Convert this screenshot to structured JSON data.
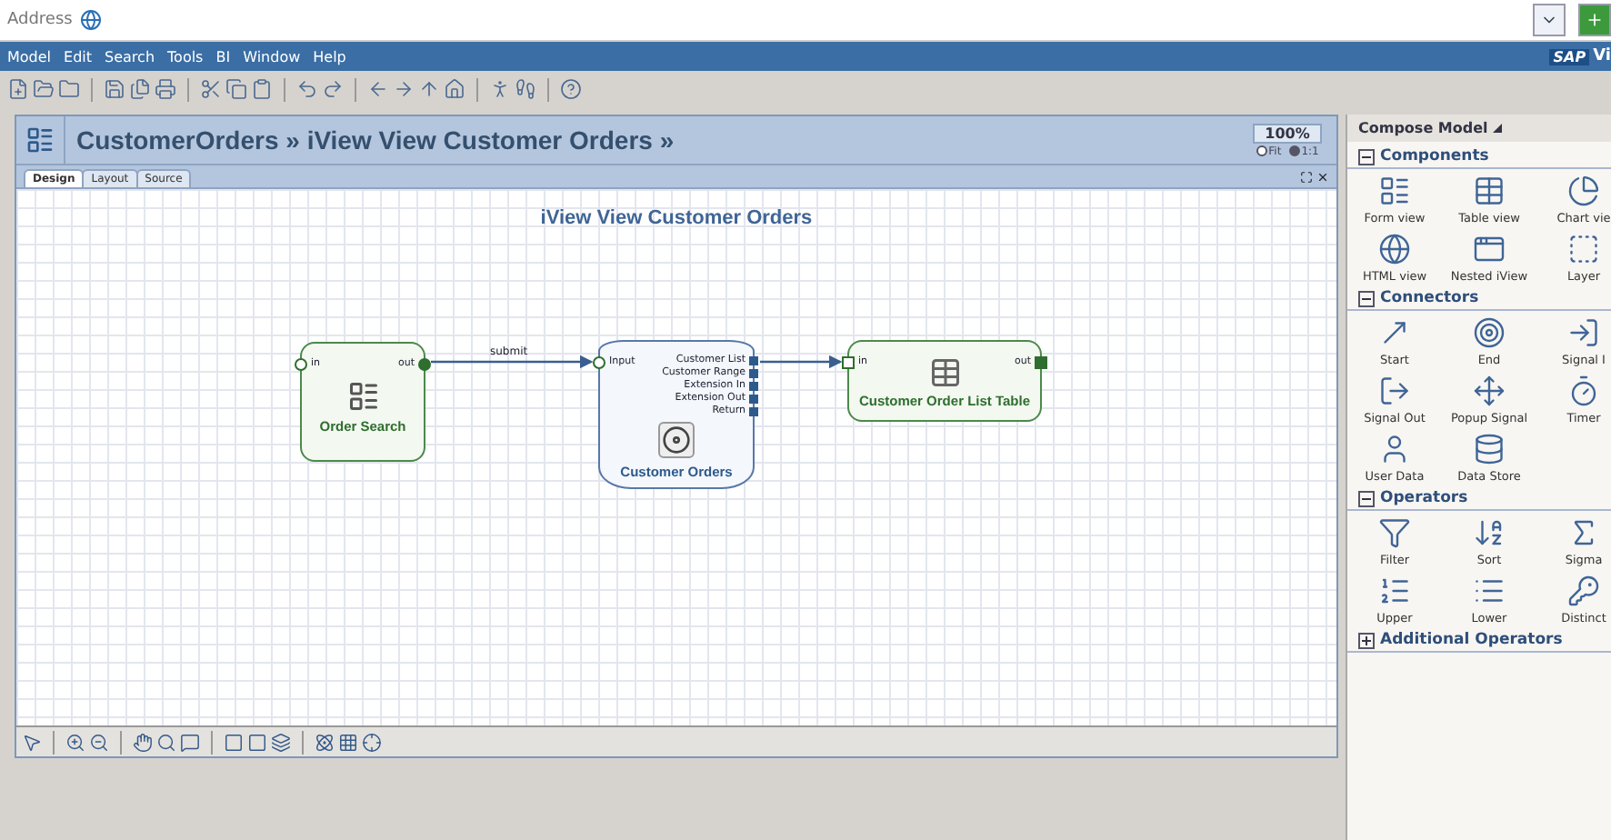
{
  "address_bar": {
    "label": "Address"
  },
  "menu_bar": {
    "items": [
      "Model",
      "Edit",
      "Search",
      "Tools",
      "BI",
      "Window",
      "Help"
    ],
    "brand": {
      "logo": "SAP",
      "text": "Vi"
    }
  },
  "editor": {
    "title": "CustomerOrders » iView View Customer Orders »",
    "zoom": "100%",
    "zoom_modes": [
      {
        "label": "Fit",
        "selected": false
      },
      {
        "label": "1:1",
        "selected": true
      }
    ],
    "tabs": [
      {
        "label": "Design",
        "selected": true
      },
      {
        "label": "Layout",
        "selected": false
      },
      {
        "label": "Source",
        "selected": false
      }
    ],
    "canvas": {
      "title": "iView View Customer Orders",
      "nodes": [
        {
          "kind": "form",
          "title": "Order Search",
          "in_port": "in",
          "out_port": "out"
        },
        {
          "kind": "service",
          "title": "Customer Orders",
          "in_port": "Input",
          "outputs": [
            "Customer List",
            "Customer Range",
            "Extension In",
            "Extension Out",
            "Return"
          ]
        },
        {
          "kind": "table",
          "title": "Customer Order List Table",
          "in_port": "in",
          "out_port": "out"
        }
      ],
      "edges": [
        {
          "kind": "labeled",
          "label": "submit"
        },
        {
          "kind": "plain"
        }
      ]
    }
  },
  "palette": {
    "title": "Compose Model",
    "sections": [
      {
        "title": "Components",
        "expanded": true,
        "items": [
          "Form view",
          "Table view",
          "Chart vie",
          "HTML view",
          "Nested iView",
          "Layer"
        ]
      },
      {
        "title": "Connectors",
        "expanded": true,
        "items": [
          "Start",
          "End",
          "Signal I",
          "Signal Out",
          "Popup Signal",
          "Timer",
          "User Data",
          "Data Store"
        ]
      },
      {
        "title": "Operators",
        "expanded": true,
        "items": [
          "Filter",
          "Sort",
          "Sigma",
          "Upper",
          "Lower",
          "Distinct"
        ]
      },
      {
        "title": "Additional Operators",
        "expanded": false
      }
    ]
  }
}
